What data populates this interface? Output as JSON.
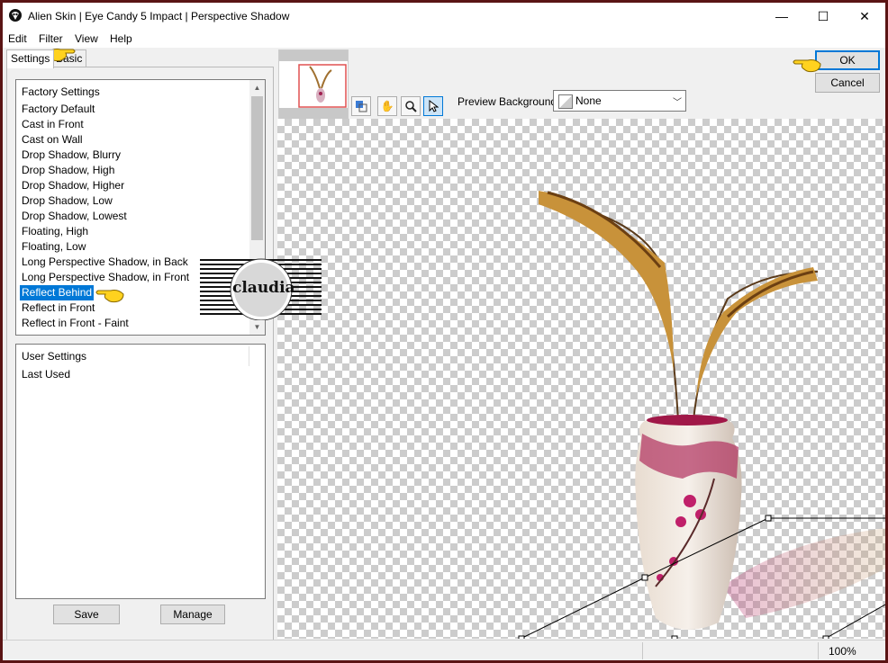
{
  "window": {
    "title": "Alien Skin | Eye Candy 5 Impact | Perspective Shadow"
  },
  "window_controls": {
    "minimize": "—",
    "maximize": "☐",
    "close": "✕"
  },
  "menu": [
    "Edit",
    "Filter",
    "View",
    "Help"
  ],
  "tabs": [
    "Settings",
    "Basic"
  ],
  "factory": {
    "header": "Factory Settings",
    "items": [
      "Factory Default",
      "Cast in Front",
      "Cast on Wall",
      "Drop Shadow, Blurry",
      "Drop Shadow, High",
      "Drop Shadow, Higher",
      "Drop Shadow, Low",
      "Drop Shadow, Lowest",
      "Floating, High",
      "Floating, Low",
      "Long Perspective Shadow, in Back",
      "Long Perspective Shadow, in Front",
      "Reflect Behind",
      "Reflect in Front",
      "Reflect in Front - Faint"
    ],
    "selected_index": 12
  },
  "user": {
    "header": "User Settings",
    "items": [
      "Last Used"
    ]
  },
  "buttons": {
    "save": "Save",
    "manage": "Manage",
    "ok": "OK",
    "cancel": "Cancel"
  },
  "preview_background": {
    "label": "Preview Background:",
    "value": "None"
  },
  "watermark": {
    "text": "claudia"
  },
  "status": {
    "zoom": "100%"
  },
  "colors": {
    "accent": "#0078d7",
    "frame": "#5a1414",
    "pointer": "#ffd21f"
  }
}
